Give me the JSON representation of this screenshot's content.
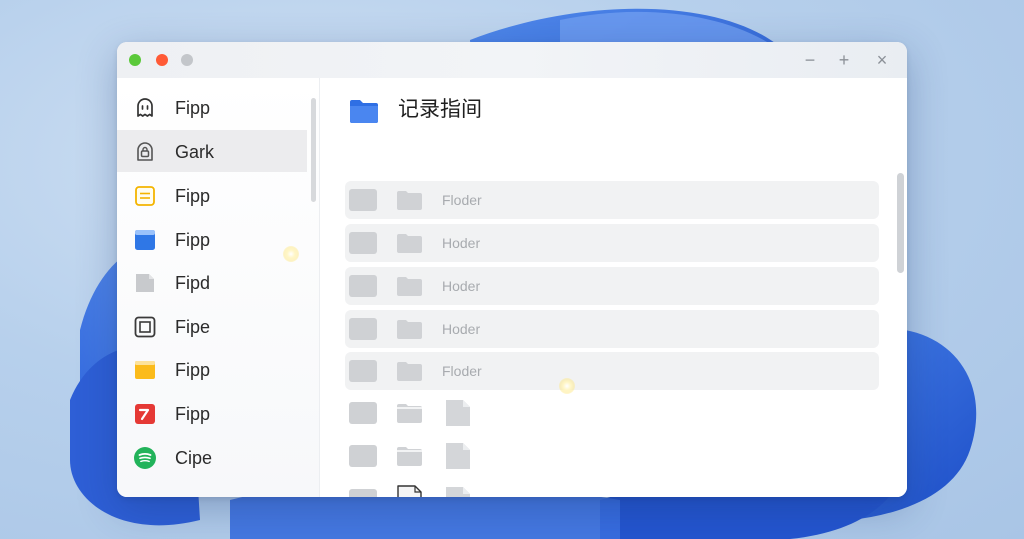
{
  "window": {
    "controls": {
      "minimize": "−",
      "maximize": "+",
      "close": "×"
    }
  },
  "sidebar": {
    "items": [
      {
        "label": "Fipp",
        "icon": "ghost-outline-icon",
        "active": false
      },
      {
        "label": "Gark",
        "icon": "lock-outline-icon",
        "active": true
      },
      {
        "label": "Fipp",
        "icon": "yellow-note-icon",
        "active": false
      },
      {
        "label": "Fipp",
        "icon": "blue-window-icon",
        "active": false
      },
      {
        "label": "Fipd",
        "icon": "gray-file-icon",
        "active": false
      },
      {
        "label": "Fipe",
        "icon": "square-frame-icon",
        "active": false
      },
      {
        "label": "Fipp",
        "icon": "yellow-folder-icon",
        "active": false
      },
      {
        "label": "Fipp",
        "icon": "red-edit-icon",
        "active": false
      },
      {
        "label": "Cipe",
        "icon": "green-spotify-icon",
        "active": false
      }
    ]
  },
  "main": {
    "title": "记录指间",
    "rows": [
      {
        "label": "Floder",
        "style": "bar",
        "kind": "folder"
      },
      {
        "label": "Hoder",
        "style": "bar",
        "kind": "folder"
      },
      {
        "label": "Hoder",
        "style": "bar",
        "kind": "folder"
      },
      {
        "label": "Hoder",
        "style": "bar",
        "kind": "folder"
      },
      {
        "label": "Floder",
        "style": "bar",
        "kind": "folder"
      },
      {
        "label": "",
        "style": "plain",
        "kind": "file"
      },
      {
        "label": "",
        "style": "plain",
        "kind": "file"
      },
      {
        "label": "",
        "style": "plain",
        "kind": "file-outline"
      }
    ]
  },
  "colors": {
    "accent_blue": "#2f6fe4",
    "traffic_green": "#5bc93a",
    "traffic_red": "#ff5a36",
    "traffic_gray": "#c3c6ca"
  }
}
